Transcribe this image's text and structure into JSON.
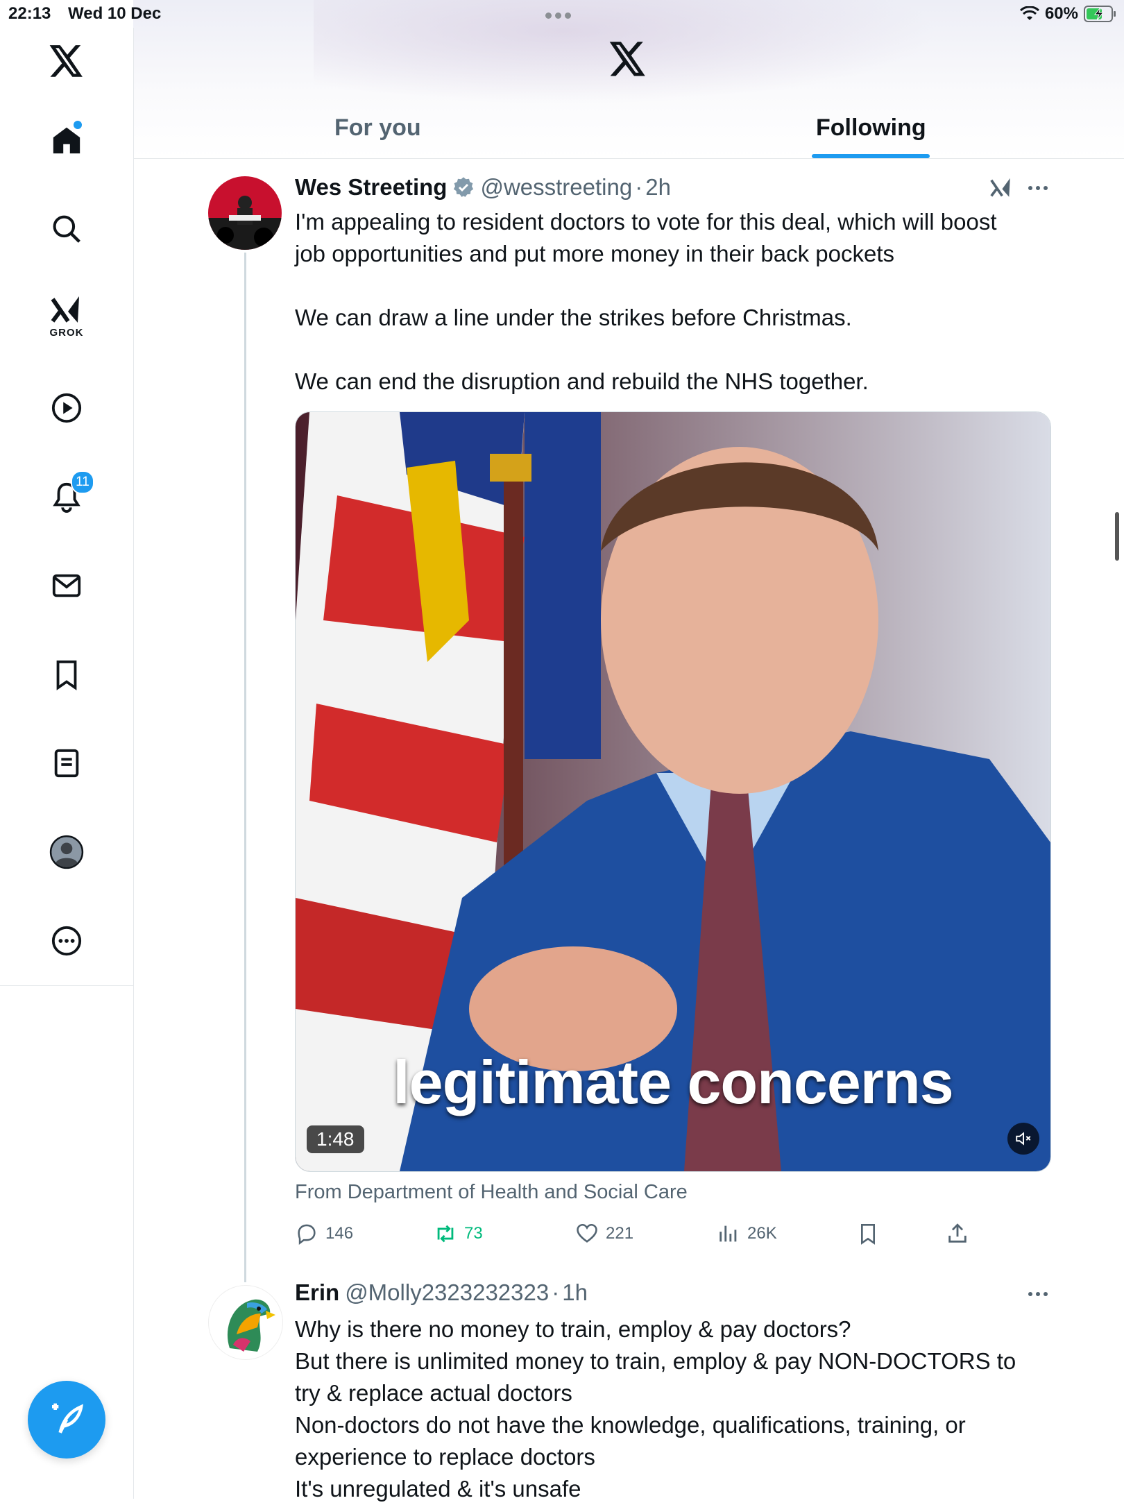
{
  "status_bar": {
    "time": "22:13",
    "date": "Wed 10 Dec",
    "battery": "60%"
  },
  "sidebar": {
    "items": [
      {
        "name": "home"
      },
      {
        "name": "search"
      },
      {
        "name": "grok",
        "label": "GROK"
      },
      {
        "name": "video"
      },
      {
        "name": "notifications",
        "badge": "11"
      },
      {
        "name": "messages"
      },
      {
        "name": "bookmarks"
      },
      {
        "name": "lists"
      },
      {
        "name": "profile"
      },
      {
        "name": "more"
      }
    ]
  },
  "tabs": {
    "for_you": "For you",
    "following": "Following",
    "active": "following"
  },
  "tweets": [
    {
      "name": "Wes Streeting",
      "verified": true,
      "handle": "@wesstreeting",
      "time": "2h",
      "lines": [
        "I'm appealing to resident doctors to vote for this deal, which will boost",
        "job opportunities and put more money in their back pockets",
        "",
        "We can draw a line under the strikes before Christmas.",
        "",
        "We can end the disruption and rebuild the NHS together."
      ],
      "video": {
        "caption": "legitimate concerns",
        "duration": "1:48"
      },
      "source": "From Department of Health and Social Care",
      "stats": {
        "replies": "146",
        "reposts": "73",
        "likes": "221",
        "views": "26K"
      }
    },
    {
      "name": "Erin",
      "handle": "@Molly2323232323",
      "time": "1h",
      "lines": [
        "Why is there no money to train, employ & pay doctors?",
        "But there is unlimited money to train, employ & pay NON-DOCTORS to",
        "try & replace actual doctors",
        "Non-doctors do not have the knowledge, qualifications, training, or",
        "experience to replace doctors",
        "It's unregulated & it's unsafe"
      ]
    }
  ],
  "colors": {
    "accent": "#1d9bf0",
    "repost": "#00ba7c",
    "muted": "#536471"
  }
}
